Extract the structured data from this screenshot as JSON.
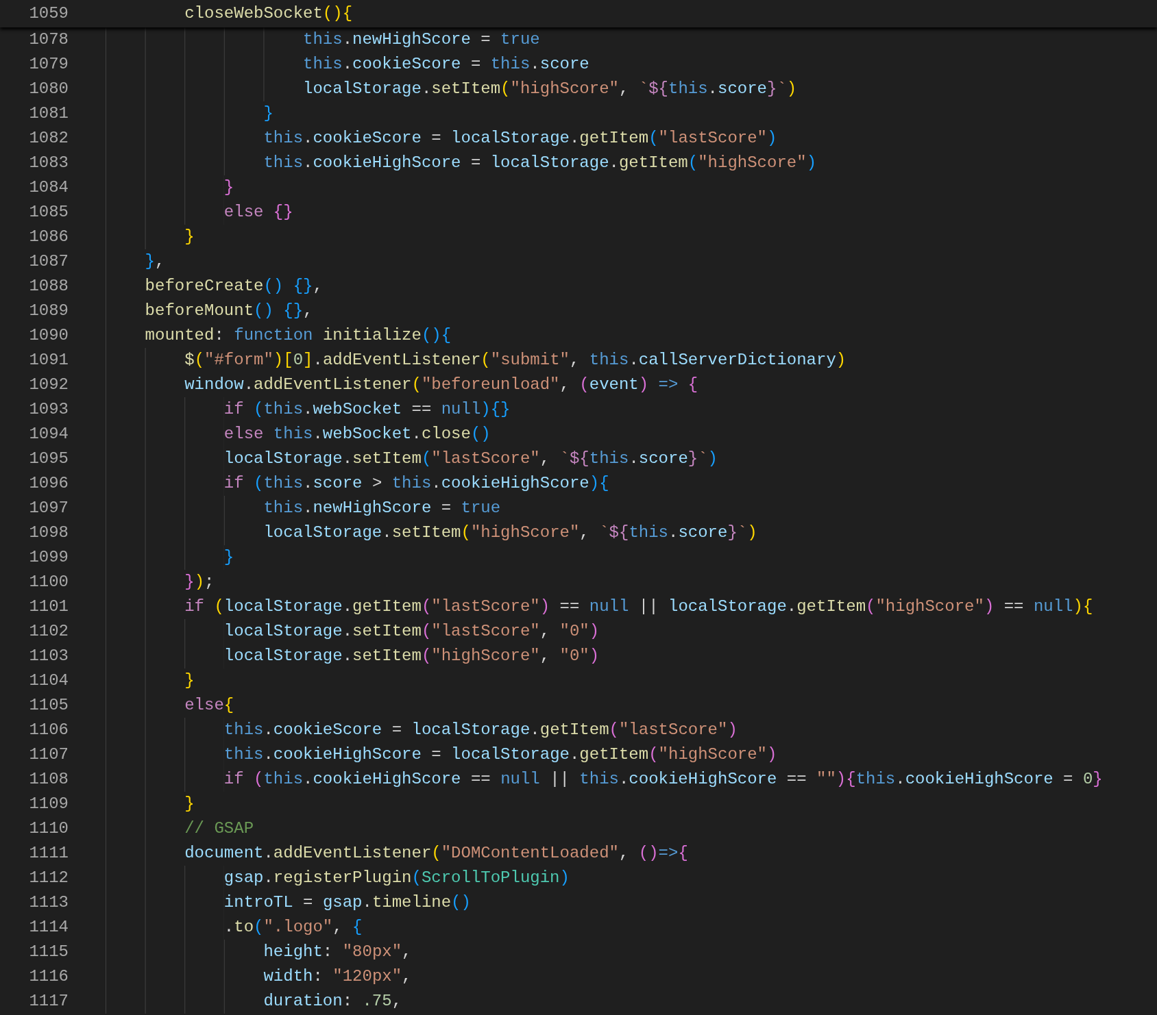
{
  "sticky_line": {
    "number": "1059",
    "tokens": [
      {
        "kind": "fn",
        "text": "        closeWebSocket"
      },
      {
        "kind": "br1",
        "text": "(){"
      }
    ]
  },
  "lines": [
    {
      "number": "1078",
      "tokens": [
        {
          "kind": "kw",
          "text": "                    this"
        },
        {
          "kind": "op",
          "text": "."
        },
        {
          "kind": "var",
          "text": "newHighScore"
        },
        {
          "kind": "op",
          "text": " = "
        },
        {
          "kind": "kw",
          "text": "true"
        }
      ]
    },
    {
      "number": "1079",
      "tokens": [
        {
          "kind": "kw",
          "text": "                    this"
        },
        {
          "kind": "op",
          "text": "."
        },
        {
          "kind": "var",
          "text": "cookieScore"
        },
        {
          "kind": "op",
          "text": " = "
        },
        {
          "kind": "kw",
          "text": "this"
        },
        {
          "kind": "op",
          "text": "."
        },
        {
          "kind": "var",
          "text": "score"
        }
      ]
    },
    {
      "number": "1080",
      "tokens": [
        {
          "kind": "var",
          "text": "                    localStorage"
        },
        {
          "kind": "op",
          "text": "."
        },
        {
          "kind": "fn",
          "text": "setItem"
        },
        {
          "kind": "br1",
          "text": "("
        },
        {
          "kind": "str",
          "text": "\"highScore\""
        },
        {
          "kind": "op",
          "text": ", "
        },
        {
          "kind": "str",
          "text": "`"
        },
        {
          "kind": "tpl",
          "text": "${"
        },
        {
          "kind": "kw",
          "text": "this"
        },
        {
          "kind": "op",
          "text": "."
        },
        {
          "kind": "var",
          "text": "score"
        },
        {
          "kind": "tpl",
          "text": "}"
        },
        {
          "kind": "str",
          "text": "`"
        },
        {
          "kind": "br1",
          "text": ")"
        }
      ]
    },
    {
      "number": "1081",
      "tokens": [
        {
          "kind": "br3",
          "text": "                }"
        }
      ]
    },
    {
      "number": "1082",
      "tokens": [
        {
          "kind": "kw",
          "text": "                this"
        },
        {
          "kind": "op",
          "text": "."
        },
        {
          "kind": "var",
          "text": "cookieScore"
        },
        {
          "kind": "op",
          "text": " = "
        },
        {
          "kind": "var",
          "text": "localStorage"
        },
        {
          "kind": "op",
          "text": "."
        },
        {
          "kind": "fn",
          "text": "getItem"
        },
        {
          "kind": "br3",
          "text": "("
        },
        {
          "kind": "str",
          "text": "\"lastScore\""
        },
        {
          "kind": "br3",
          "text": ")"
        }
      ]
    },
    {
      "number": "1083",
      "tokens": [
        {
          "kind": "kw",
          "text": "                this"
        },
        {
          "kind": "op",
          "text": "."
        },
        {
          "kind": "var",
          "text": "cookieHighScore"
        },
        {
          "kind": "op",
          "text": " = "
        },
        {
          "kind": "var",
          "text": "localStorage"
        },
        {
          "kind": "op",
          "text": "."
        },
        {
          "kind": "fn",
          "text": "getItem"
        },
        {
          "kind": "br3",
          "text": "("
        },
        {
          "kind": "str",
          "text": "\"highScore\""
        },
        {
          "kind": "br3",
          "text": ")"
        }
      ]
    },
    {
      "number": "1084",
      "tokens": [
        {
          "kind": "br2",
          "text": "            }"
        }
      ]
    },
    {
      "number": "1085",
      "tokens": [
        {
          "kind": "ctl",
          "text": "            else "
        },
        {
          "kind": "br2",
          "text": "{}"
        }
      ]
    },
    {
      "number": "1086",
      "tokens": [
        {
          "kind": "br1",
          "text": "        }"
        }
      ]
    },
    {
      "number": "1087",
      "tokens": [
        {
          "kind": "br3",
          "text": "    }"
        },
        {
          "kind": "op",
          "text": ","
        }
      ]
    },
    {
      "number": "1088",
      "tokens": [
        {
          "kind": "fn",
          "text": "    beforeCreate"
        },
        {
          "kind": "br3",
          "text": "() {}"
        },
        {
          "kind": "op",
          "text": ","
        }
      ]
    },
    {
      "number": "1089",
      "tokens": [
        {
          "kind": "fn",
          "text": "    beforeMount"
        },
        {
          "kind": "br3",
          "text": "() {}"
        },
        {
          "kind": "op",
          "text": ","
        }
      ]
    },
    {
      "number": "1090",
      "tokens": [
        {
          "kind": "fn",
          "text": "    mounted"
        },
        {
          "kind": "op",
          "text": ": "
        },
        {
          "kind": "kw",
          "text": "function "
        },
        {
          "kind": "fn",
          "text": "initialize"
        },
        {
          "kind": "br3",
          "text": "(){"
        }
      ]
    },
    {
      "number": "1091",
      "tokens": [
        {
          "kind": "fn",
          "text": "        $"
        },
        {
          "kind": "br1",
          "text": "("
        },
        {
          "kind": "str",
          "text": "\"#form\""
        },
        {
          "kind": "br1",
          "text": ")["
        },
        {
          "kind": "num",
          "text": "0"
        },
        {
          "kind": "br1",
          "text": "]"
        },
        {
          "kind": "op",
          "text": "."
        },
        {
          "kind": "fn",
          "text": "addEventListener"
        },
        {
          "kind": "br1",
          "text": "("
        },
        {
          "kind": "str",
          "text": "\"submit\""
        },
        {
          "kind": "op",
          "text": ", "
        },
        {
          "kind": "kw",
          "text": "this"
        },
        {
          "kind": "op",
          "text": "."
        },
        {
          "kind": "var",
          "text": "callServerDictionary"
        },
        {
          "kind": "br1",
          "text": ")"
        }
      ]
    },
    {
      "number": "1092",
      "tokens": [
        {
          "kind": "var",
          "text": "        window"
        },
        {
          "kind": "op",
          "text": "."
        },
        {
          "kind": "fn",
          "text": "addEventListener"
        },
        {
          "kind": "br1",
          "text": "("
        },
        {
          "kind": "str",
          "text": "\"beforeunload\""
        },
        {
          "kind": "op",
          "text": ", "
        },
        {
          "kind": "br2",
          "text": "("
        },
        {
          "kind": "var",
          "text": "event"
        },
        {
          "kind": "br2",
          "text": ") "
        },
        {
          "kind": "kw",
          "text": "=> "
        },
        {
          "kind": "br2",
          "text": "{"
        }
      ]
    },
    {
      "number": "1093",
      "tokens": [
        {
          "kind": "ctl",
          "text": "            if "
        },
        {
          "kind": "br3",
          "text": "("
        },
        {
          "kind": "kw",
          "text": "this"
        },
        {
          "kind": "op",
          "text": "."
        },
        {
          "kind": "var",
          "text": "webSocket"
        },
        {
          "kind": "op",
          "text": " == "
        },
        {
          "kind": "kw",
          "text": "null"
        },
        {
          "kind": "br3",
          "text": "){}"
        }
      ]
    },
    {
      "number": "1094",
      "tokens": [
        {
          "kind": "ctl",
          "text": "            else "
        },
        {
          "kind": "kw",
          "text": "this"
        },
        {
          "kind": "op",
          "text": "."
        },
        {
          "kind": "var",
          "text": "webSocket"
        },
        {
          "kind": "op",
          "text": "."
        },
        {
          "kind": "fn",
          "text": "close"
        },
        {
          "kind": "br3",
          "text": "()"
        }
      ]
    },
    {
      "number": "1095",
      "tokens": [
        {
          "kind": "var",
          "text": "            localStorage"
        },
        {
          "kind": "op",
          "text": "."
        },
        {
          "kind": "fn",
          "text": "setItem"
        },
        {
          "kind": "br3",
          "text": "("
        },
        {
          "kind": "str",
          "text": "\"lastScore\""
        },
        {
          "kind": "op",
          "text": ", "
        },
        {
          "kind": "str",
          "text": "`"
        },
        {
          "kind": "tpl",
          "text": "${"
        },
        {
          "kind": "kw",
          "text": "this"
        },
        {
          "kind": "op",
          "text": "."
        },
        {
          "kind": "var",
          "text": "score"
        },
        {
          "kind": "tpl",
          "text": "}"
        },
        {
          "kind": "str",
          "text": "`"
        },
        {
          "kind": "br3",
          "text": ")"
        }
      ]
    },
    {
      "number": "1096",
      "tokens": [
        {
          "kind": "ctl",
          "text": "            if "
        },
        {
          "kind": "br3",
          "text": "("
        },
        {
          "kind": "kw",
          "text": "this"
        },
        {
          "kind": "op",
          "text": "."
        },
        {
          "kind": "var",
          "text": "score"
        },
        {
          "kind": "op",
          "text": " > "
        },
        {
          "kind": "kw",
          "text": "this"
        },
        {
          "kind": "op",
          "text": "."
        },
        {
          "kind": "var",
          "text": "cookieHighScore"
        },
        {
          "kind": "br3",
          "text": "){"
        }
      ]
    },
    {
      "number": "1097",
      "tokens": [
        {
          "kind": "kw",
          "text": "                this"
        },
        {
          "kind": "op",
          "text": "."
        },
        {
          "kind": "var",
          "text": "newHighScore"
        },
        {
          "kind": "op",
          "text": " = "
        },
        {
          "kind": "kw",
          "text": "true"
        }
      ]
    },
    {
      "number": "1098",
      "tokens": [
        {
          "kind": "var",
          "text": "                localStorage"
        },
        {
          "kind": "op",
          "text": "."
        },
        {
          "kind": "fn",
          "text": "setItem"
        },
        {
          "kind": "br1",
          "text": "("
        },
        {
          "kind": "str",
          "text": "\"highScore\""
        },
        {
          "kind": "op",
          "text": ", "
        },
        {
          "kind": "str",
          "text": "`"
        },
        {
          "kind": "tpl",
          "text": "${"
        },
        {
          "kind": "kw",
          "text": "this"
        },
        {
          "kind": "op",
          "text": "."
        },
        {
          "kind": "var",
          "text": "score"
        },
        {
          "kind": "tpl",
          "text": "}"
        },
        {
          "kind": "str",
          "text": "`"
        },
        {
          "kind": "br1",
          "text": ")"
        }
      ]
    },
    {
      "number": "1099",
      "tokens": [
        {
          "kind": "br3",
          "text": "            }"
        }
      ]
    },
    {
      "number": "1100",
      "tokens": [
        {
          "kind": "br2",
          "text": "        }"
        },
        {
          "kind": "br1",
          "text": ")"
        },
        {
          "kind": "op",
          "text": ";"
        }
      ]
    },
    {
      "number": "1101",
      "tokens": [
        {
          "kind": "ctl",
          "text": "        if "
        },
        {
          "kind": "br1",
          "text": "("
        },
        {
          "kind": "var",
          "text": "localStorage"
        },
        {
          "kind": "op",
          "text": "."
        },
        {
          "kind": "fn",
          "text": "getItem"
        },
        {
          "kind": "br2",
          "text": "("
        },
        {
          "kind": "str",
          "text": "\"lastScore\""
        },
        {
          "kind": "br2",
          "text": ")"
        },
        {
          "kind": "op",
          "text": " == "
        },
        {
          "kind": "kw",
          "text": "null"
        },
        {
          "kind": "op",
          "text": " || "
        },
        {
          "kind": "var",
          "text": "localStorage"
        },
        {
          "kind": "op",
          "text": "."
        },
        {
          "kind": "fn",
          "text": "getItem"
        },
        {
          "kind": "br2",
          "text": "("
        },
        {
          "kind": "str",
          "text": "\"highScore\""
        },
        {
          "kind": "br2",
          "text": ")"
        },
        {
          "kind": "op",
          "text": " == "
        },
        {
          "kind": "kw",
          "text": "null"
        },
        {
          "kind": "br1",
          "text": "){"
        }
      ]
    },
    {
      "number": "1102",
      "tokens": [
        {
          "kind": "var",
          "text": "            localStorage"
        },
        {
          "kind": "op",
          "text": "."
        },
        {
          "kind": "fn",
          "text": "setItem"
        },
        {
          "kind": "br2",
          "text": "("
        },
        {
          "kind": "str",
          "text": "\"lastScore\""
        },
        {
          "kind": "op",
          "text": ", "
        },
        {
          "kind": "str",
          "text": "\"0\""
        },
        {
          "kind": "br2",
          "text": ")"
        }
      ]
    },
    {
      "number": "1103",
      "tokens": [
        {
          "kind": "var",
          "text": "            localStorage"
        },
        {
          "kind": "op",
          "text": "."
        },
        {
          "kind": "fn",
          "text": "setItem"
        },
        {
          "kind": "br2",
          "text": "("
        },
        {
          "kind": "str",
          "text": "\"highScore\""
        },
        {
          "kind": "op",
          "text": ", "
        },
        {
          "kind": "str",
          "text": "\"0\""
        },
        {
          "kind": "br2",
          "text": ")"
        }
      ]
    },
    {
      "number": "1104",
      "tokens": [
        {
          "kind": "br1",
          "text": "        }"
        }
      ]
    },
    {
      "number": "1105",
      "tokens": [
        {
          "kind": "ctl",
          "text": "        else"
        },
        {
          "kind": "br1",
          "text": "{"
        }
      ]
    },
    {
      "number": "1106",
      "tokens": [
        {
          "kind": "kw",
          "text": "            this"
        },
        {
          "kind": "op",
          "text": "."
        },
        {
          "kind": "var",
          "text": "cookieScore"
        },
        {
          "kind": "op",
          "text": " = "
        },
        {
          "kind": "var",
          "text": "localStorage"
        },
        {
          "kind": "op",
          "text": "."
        },
        {
          "kind": "fn",
          "text": "getItem"
        },
        {
          "kind": "br2",
          "text": "("
        },
        {
          "kind": "str",
          "text": "\"lastScore\""
        },
        {
          "kind": "br2",
          "text": ")"
        }
      ]
    },
    {
      "number": "1107",
      "tokens": [
        {
          "kind": "kw",
          "text": "            this"
        },
        {
          "kind": "op",
          "text": "."
        },
        {
          "kind": "var",
          "text": "cookieHighScore"
        },
        {
          "kind": "op",
          "text": " = "
        },
        {
          "kind": "var",
          "text": "localStorage"
        },
        {
          "kind": "op",
          "text": "."
        },
        {
          "kind": "fn",
          "text": "getItem"
        },
        {
          "kind": "br2",
          "text": "("
        },
        {
          "kind": "str",
          "text": "\"highScore\""
        },
        {
          "kind": "br2",
          "text": ")"
        }
      ]
    },
    {
      "number": "1108",
      "tokens": [
        {
          "kind": "ctl",
          "text": "            if "
        },
        {
          "kind": "br2",
          "text": "("
        },
        {
          "kind": "kw",
          "text": "this"
        },
        {
          "kind": "op",
          "text": "."
        },
        {
          "kind": "var",
          "text": "cookieHighScore"
        },
        {
          "kind": "op",
          "text": " == "
        },
        {
          "kind": "kw",
          "text": "null"
        },
        {
          "kind": "op",
          "text": " || "
        },
        {
          "kind": "kw",
          "text": "this"
        },
        {
          "kind": "op",
          "text": "."
        },
        {
          "kind": "var",
          "text": "cookieHighScore"
        },
        {
          "kind": "op",
          "text": " == "
        },
        {
          "kind": "str",
          "text": "\"\""
        },
        {
          "kind": "br2",
          "text": "){"
        },
        {
          "kind": "kw",
          "text": "this"
        },
        {
          "kind": "op",
          "text": "."
        },
        {
          "kind": "var",
          "text": "cookieHighScore"
        },
        {
          "kind": "op",
          "text": " = "
        },
        {
          "kind": "num",
          "text": "0"
        },
        {
          "kind": "br2",
          "text": "}"
        }
      ]
    },
    {
      "number": "1109",
      "tokens": [
        {
          "kind": "br1",
          "text": "        }"
        }
      ]
    },
    {
      "number": "1110",
      "tokens": [
        {
          "kind": "cmt",
          "text": "        // GSAP"
        }
      ]
    },
    {
      "number": "1111",
      "tokens": [
        {
          "kind": "var",
          "text": "        document"
        },
        {
          "kind": "op",
          "text": "."
        },
        {
          "kind": "fn",
          "text": "addEventListener"
        },
        {
          "kind": "br1",
          "text": "("
        },
        {
          "kind": "str",
          "text": "\"DOMContentLoaded\""
        },
        {
          "kind": "op",
          "text": ", "
        },
        {
          "kind": "br2",
          "text": "()"
        },
        {
          "kind": "kw",
          "text": "=>"
        },
        {
          "kind": "br2",
          "text": "{"
        }
      ]
    },
    {
      "number": "1112",
      "tokens": [
        {
          "kind": "var",
          "text": "            gsap"
        },
        {
          "kind": "op",
          "text": "."
        },
        {
          "kind": "fn",
          "text": "registerPlugin"
        },
        {
          "kind": "br3",
          "text": "("
        },
        {
          "kind": "cls",
          "text": "ScrollToPlugin"
        },
        {
          "kind": "br3",
          "text": ")"
        }
      ]
    },
    {
      "number": "1113",
      "tokens": [
        {
          "kind": "var",
          "text": "            introTL"
        },
        {
          "kind": "op",
          "text": " = "
        },
        {
          "kind": "var",
          "text": "gsap"
        },
        {
          "kind": "op",
          "text": "."
        },
        {
          "kind": "fn",
          "text": "timeline"
        },
        {
          "kind": "br3",
          "text": "()"
        }
      ]
    },
    {
      "number": "1114",
      "tokens": [
        {
          "kind": "op",
          "text": "            ."
        },
        {
          "kind": "fn",
          "text": "to"
        },
        {
          "kind": "br3",
          "text": "("
        },
        {
          "kind": "str",
          "text": "\".logo\""
        },
        {
          "kind": "op",
          "text": ", "
        },
        {
          "kind": "br3",
          "text": "{"
        }
      ]
    },
    {
      "number": "1115",
      "tokens": [
        {
          "kind": "var",
          "text": "                height"
        },
        {
          "kind": "op",
          "text": ": "
        },
        {
          "kind": "str",
          "text": "\"80px\""
        },
        {
          "kind": "op",
          "text": ","
        }
      ]
    },
    {
      "number": "1116",
      "tokens": [
        {
          "kind": "var",
          "text": "                width"
        },
        {
          "kind": "op",
          "text": ": "
        },
        {
          "kind": "str",
          "text": "\"120px\""
        },
        {
          "kind": "op",
          "text": ","
        }
      ]
    },
    {
      "number": "1117",
      "tokens": [
        {
          "kind": "var",
          "text": "                duration"
        },
        {
          "kind": "op",
          "text": ": "
        },
        {
          "kind": "num",
          "text": ".75"
        },
        {
          "kind": "op",
          "text": ","
        }
      ]
    }
  ]
}
